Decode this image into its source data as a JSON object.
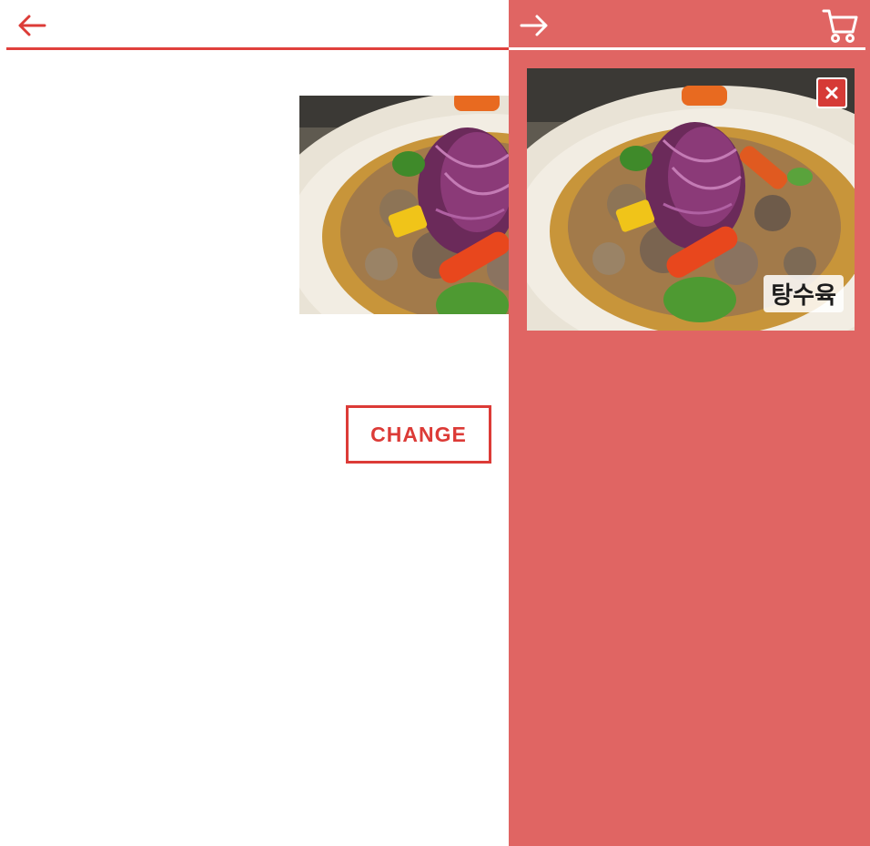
{
  "main": {
    "change_label": "CHANGE"
  },
  "icons": {
    "back": "arrow-left-icon",
    "forward": "arrow-right-icon",
    "cart": "cart-icon",
    "remove": "close-icon"
  },
  "cart": {
    "items": [
      {
        "label": "탕수육"
      }
    ]
  },
  "colors": {
    "accent": "#dc3b37",
    "drawer_bg": "#e06563",
    "remove_bg": "#d63a36"
  }
}
